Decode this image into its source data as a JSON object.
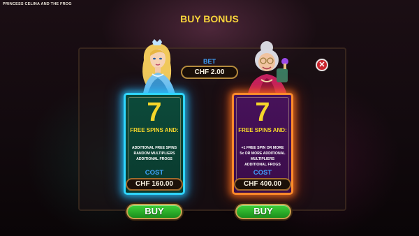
{
  "game": {
    "title": "PRINCESS CELINA AND THE FROG"
  },
  "popup": {
    "title": "BUY BONUS",
    "bet_label": "BET",
    "bet_value": "CHF 2.00",
    "close_icon": "close-icon"
  },
  "offers": [
    {
      "character": "princess",
      "spins": "7",
      "spins_label": "FREE SPINS AND:",
      "features": [
        "ADDITIONAL FREE SPINS",
        "RANDOM MULTIPLIERS",
        "ADDITIONAL FROGS"
      ],
      "cost_label": "COST",
      "cost_value": "CHF 160.00",
      "buy_label": "BUY",
      "accent": "#2fd5ff"
    },
    {
      "character": "grandmother",
      "spins": "7",
      "spins_label": "FREE SPINS AND:",
      "features": [
        "+1 FREE SPIN OR MORE",
        "5x OR MORE ADDITIONAL",
        "MULTIPLIERS",
        "ADDITIONAL FROGS"
      ],
      "cost_label": "COST",
      "cost_value": "CHF 400.00",
      "buy_label": "BUY",
      "accent": "#ff8a2a"
    }
  ],
  "colors": {
    "gold": "#f5d62a",
    "blue_label": "#3fa4ff",
    "buy_green": "#2fb52c",
    "close_red": "#c9252e"
  }
}
